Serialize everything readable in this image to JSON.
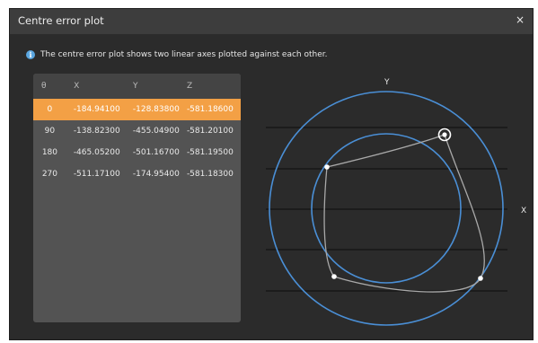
{
  "dialog": {
    "title": "Centre error plot",
    "close_label": "×"
  },
  "info": {
    "icon": "info-icon",
    "text": "The centre error plot shows two linear axes plotted against each other."
  },
  "table": {
    "headers": [
      "θ",
      "X",
      "Y",
      "Z"
    ],
    "rows": [
      {
        "theta": "0",
        "x": "-184.94100",
        "y": "-128.83800",
        "z": "-581.18600",
        "selected": true
      },
      {
        "theta": "90",
        "x": "-138.82300",
        "y": "-455.04900",
        "z": "-581.20100",
        "selected": false
      },
      {
        "theta": "180",
        "x": "-465.05200",
        "y": "-501.16700",
        "z": "-581.19500",
        "selected": false
      },
      {
        "theta": "270",
        "x": "-511.17100",
        "y": "-174.95400",
        "z": "-581.18300",
        "selected": false
      }
    ]
  },
  "plot": {
    "x_axis_label": "X",
    "y_axis_label": "Y",
    "circle_color": "#4a8fd6",
    "path_color": "#a9a9a9",
    "selected_marker": "target-marker"
  },
  "colors": {
    "selected_row": "#f3a045",
    "dialog_bg": "#2b2b2b"
  }
}
